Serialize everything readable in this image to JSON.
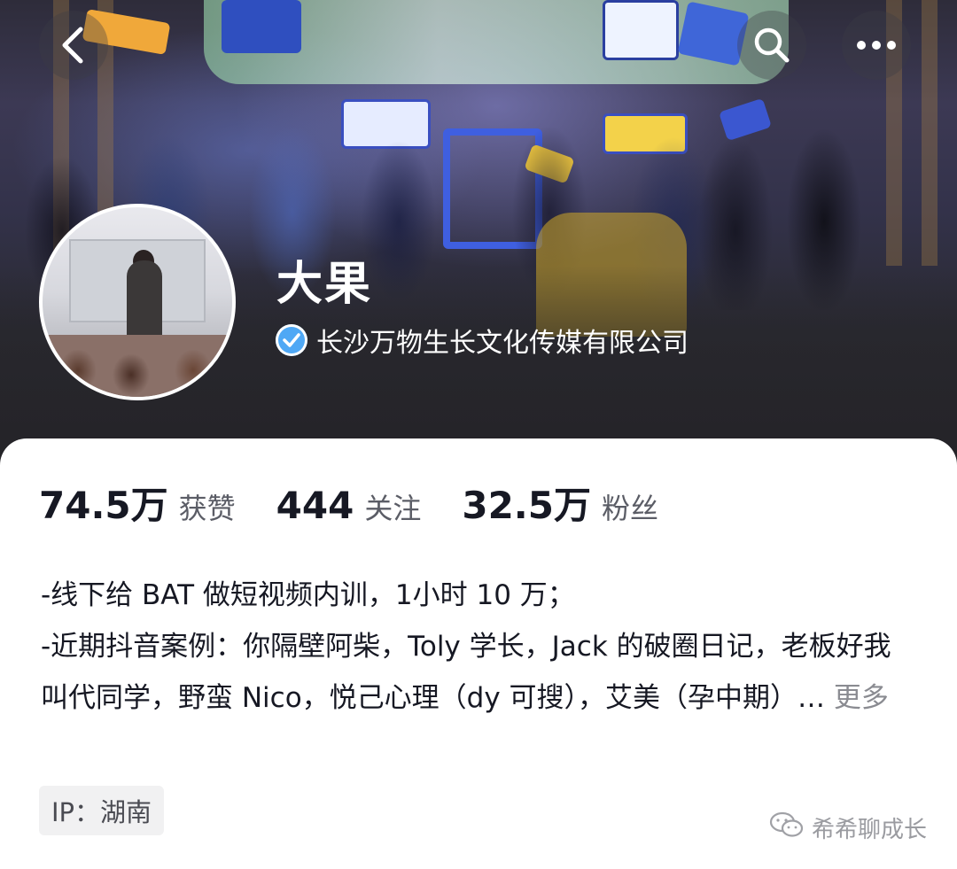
{
  "header": {
    "back_icon": "chevron-left-icon",
    "search_icon": "search-icon",
    "more_icon": "more-dots-icon"
  },
  "profile": {
    "name": "大果",
    "verified_org": "长沙万物生长文化传媒有限公司",
    "verified_icon": "check-badge-icon",
    "verified_color": "#4fa8f5"
  },
  "stats": [
    {
      "value": "74.5万",
      "label": "获赞"
    },
    {
      "value": "444",
      "label": "关注"
    },
    {
      "value": "32.5万",
      "label": "粉丝"
    }
  ],
  "bio": {
    "line1": "-线下给 BAT 做短视频内训，1小时 10 万；",
    "line2": "-近期抖音案例：你隔壁阿柴，Toly 学长，Jack 的破圈日记，老板好我叫代同学，野蛮 Nico，悦己心理（dy 可搜），艾美（孕中期）…",
    "more_label": "更多"
  },
  "ip_tag": "IP：湖南",
  "watermark": {
    "icon": "wechat-icon",
    "text": "希希聊成长"
  }
}
